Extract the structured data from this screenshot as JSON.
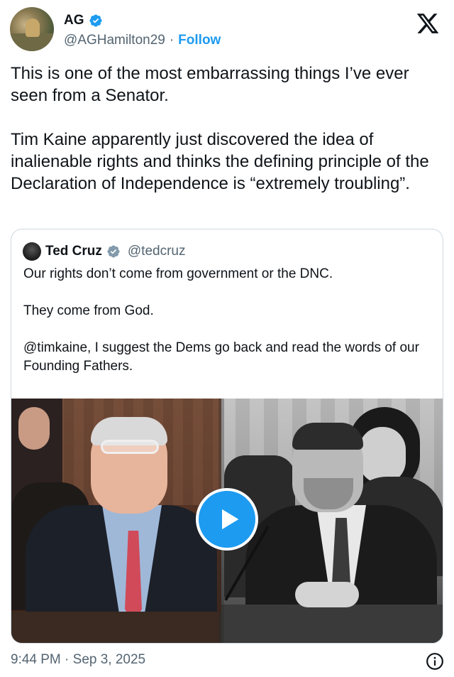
{
  "author": {
    "display_name": "AG",
    "handle": "@AGHamilton29",
    "separator": "·",
    "follow_label": "Follow",
    "verified": true
  },
  "tweet": {
    "paragraphs": [
      "This is one of the most embarrassing things I’ve ever seen from a Senator.",
      "Tim Kaine apparently just discovered the idea of inalienable rights and thinks the defining principle of the Declaration of Independence is “extremely troubling”."
    ]
  },
  "quote": {
    "display_name": "Ted Cruz",
    "handle": "@tedcruz",
    "verified": true,
    "paragraphs": [
      "Our rights don’t come from government or the DNC.",
      "They come from God.",
      "@timkaine, I suggest the Dems go back and read the words of our Founding Fathers."
    ],
    "media": {
      "type": "video",
      "play_icon": "play-icon"
    }
  },
  "footer": {
    "timestamp": "9:44 PM · Sep 3, 2025",
    "info_icon": "info-icon"
  },
  "colors": {
    "accent": "#1d9bf0",
    "text": "#0f1419",
    "secondary": "#536471",
    "border": "#cfd9de"
  }
}
